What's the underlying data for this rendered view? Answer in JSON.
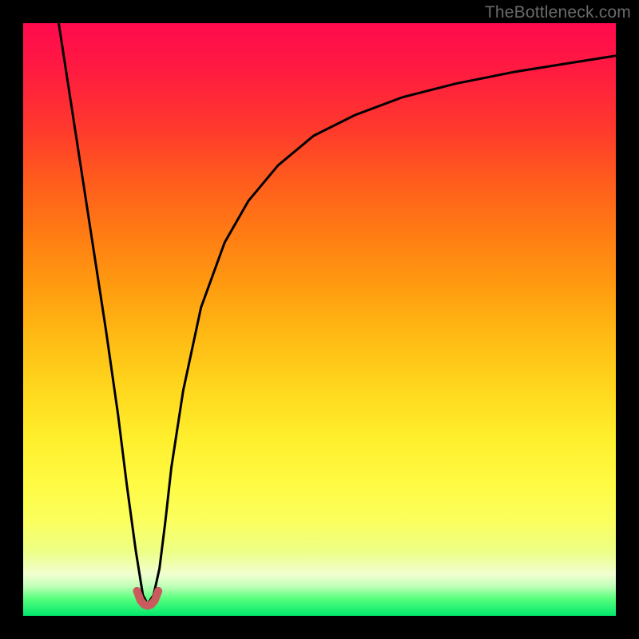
{
  "watermark": "TheBottleneck.com",
  "chart_data": {
    "type": "line",
    "title": "",
    "xlabel": "",
    "ylabel": "",
    "xlim": [
      0,
      100
    ],
    "ylim": [
      0,
      100
    ],
    "grid": false,
    "series": [
      {
        "name": "black-curve",
        "stroke": "#000000",
        "width": 3,
        "x": [
          6,
          8,
          10,
          12,
          14,
          16,
          17.5,
          19,
          20.2,
          21,
          22,
          23,
          24,
          25,
          27,
          30,
          34,
          38,
          43,
          49,
          56,
          64,
          73,
          83,
          93,
          100
        ],
        "values": [
          100,
          87,
          74,
          61,
          48,
          34,
          22,
          11,
          3.5,
          2,
          3.5,
          8,
          16,
          25,
          38,
          52,
          63,
          70,
          76,
          81,
          84.5,
          87.5,
          89.8,
          91.8,
          93.4,
          94.5
        ]
      },
      {
        "name": "red-u-marker",
        "stroke": "#cb5a5f",
        "width": 10,
        "x": [
          19.2,
          19.8,
          20.4,
          21.0,
          21.6,
          22.2,
          22.8
        ],
        "values": [
          4.2,
          2.6,
          1.9,
          1.7,
          1.9,
          2.6,
          4.2
        ]
      }
    ],
    "background_gradient": {
      "top_color": "#ff0a4e",
      "mid_color": "#ffe030",
      "bottom_color": "#00e86c"
    }
  }
}
